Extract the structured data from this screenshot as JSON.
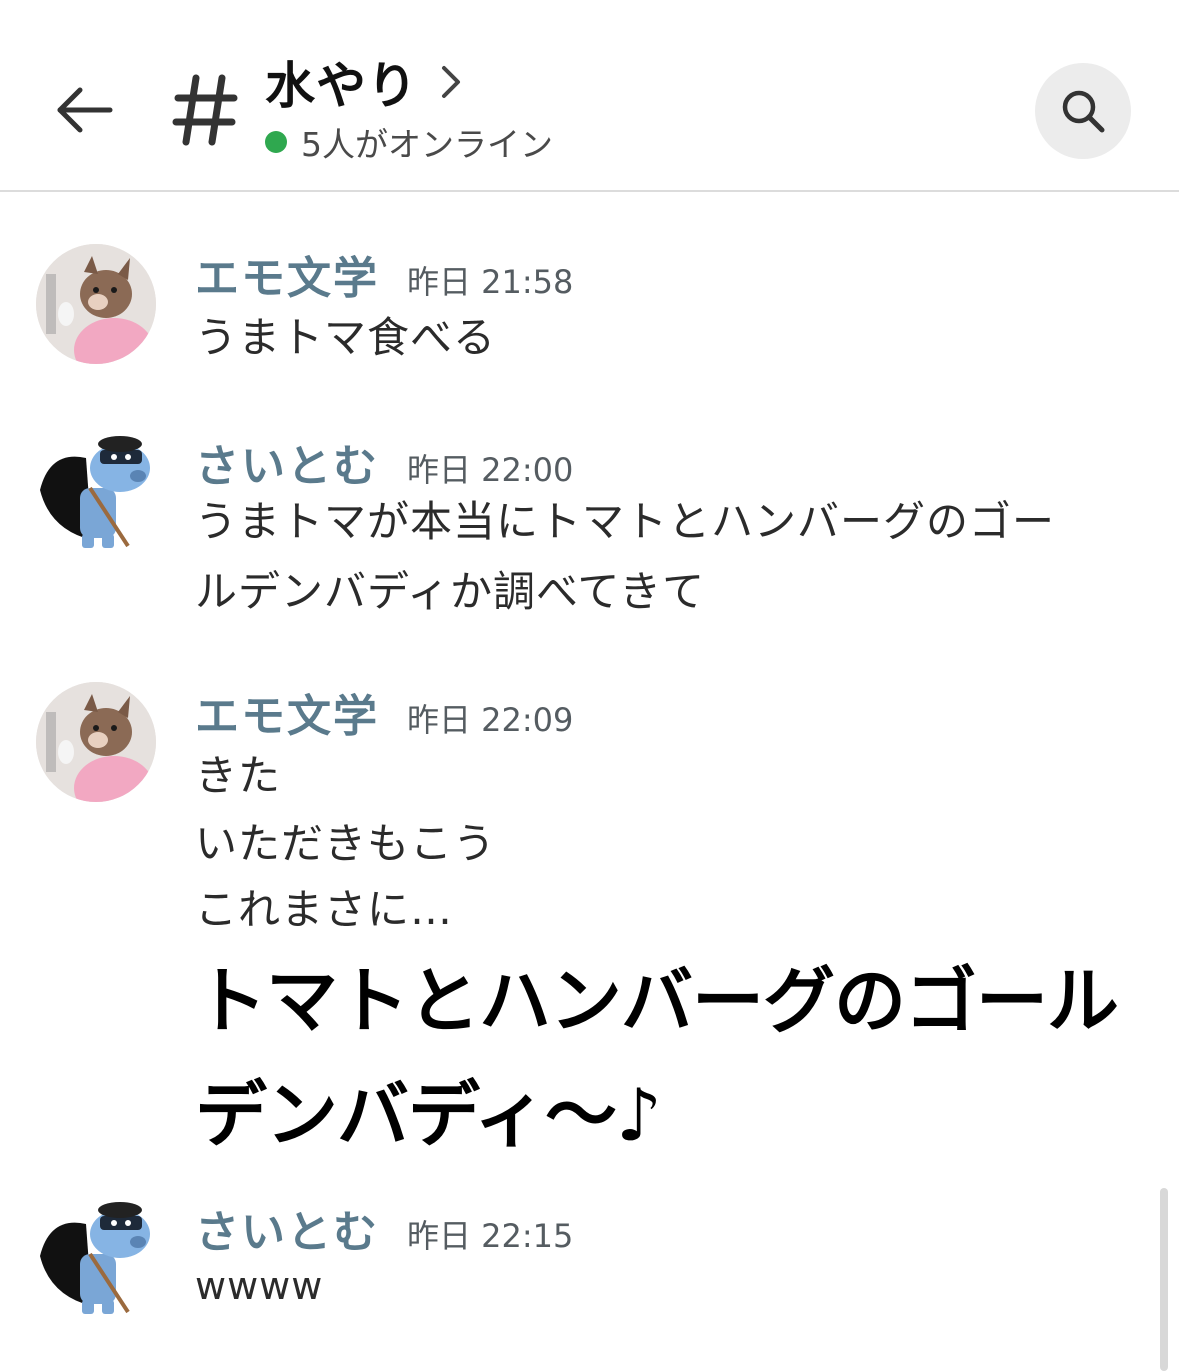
{
  "header": {
    "channel_title": "水やり",
    "online_status": "5人がオンライン",
    "online_color": "#2fa84f",
    "icons": [
      "back-arrow-icon",
      "hash-icon",
      "chevron-right-icon",
      "search-icon"
    ]
  },
  "messages": [
    {
      "sender": "エモ文学",
      "time": "昨日 21:58",
      "avatar": "dog-photo-avatar",
      "lines": [
        "うまトマ食べる"
      ]
    },
    {
      "sender": "さいとむ",
      "time": "昨日 22:00",
      "avatar": "cartoon-robot-avatar",
      "lines": [
        "うまトマが本当にトマトとハンバーグのゴー",
        "ルデンバディか調べてきて"
      ]
    },
    {
      "sender": "エモ文学",
      "time": "昨日 22:09",
      "avatar": "dog-photo-avatar",
      "lines": [
        "きた",
        "いただきもこう",
        "これまさに…"
      ],
      "big_lines": [
        "トマトとハンバーグのゴール",
        "デンバディ～♪"
      ]
    },
    {
      "sender": "さいとむ",
      "time": "昨日 22:15",
      "avatar": "cartoon-robot-avatar",
      "lines": [
        "wwww"
      ]
    }
  ],
  "colors": {
    "sender": "#5a7a8c",
    "text": "#2b2b2b",
    "divider": "#dcdcdc"
  }
}
